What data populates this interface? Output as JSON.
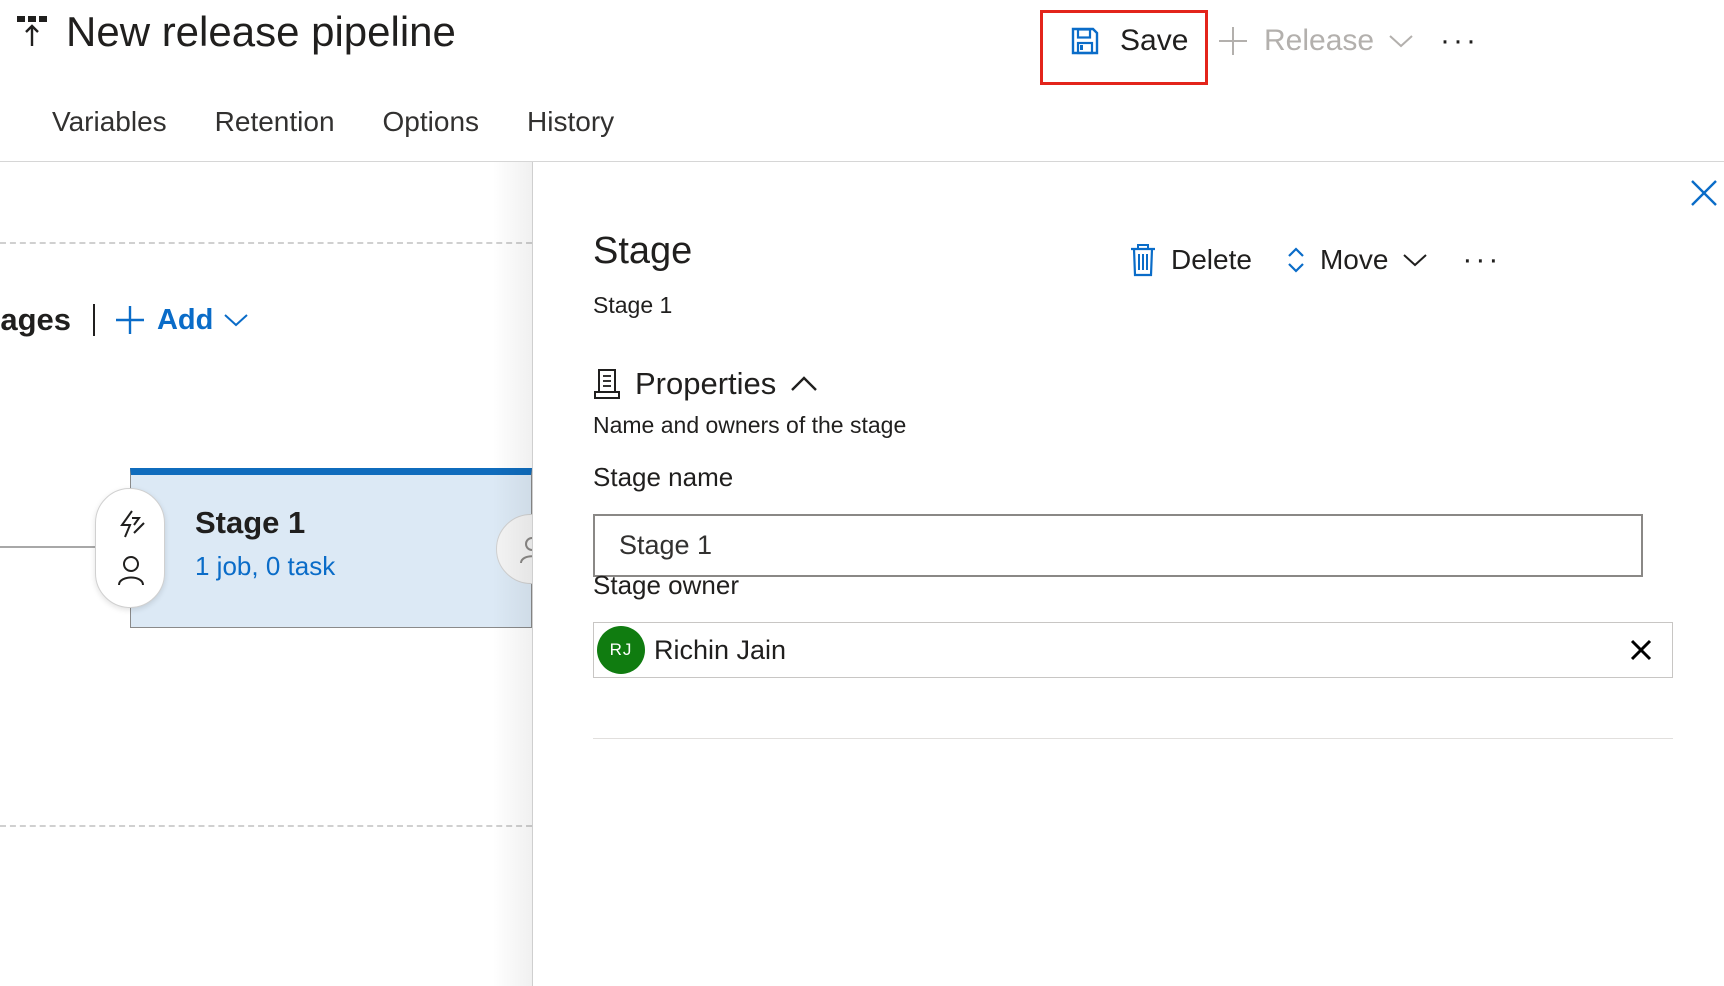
{
  "header": {
    "title": "New release pipeline",
    "pipeline_icon": "release-pipeline-icon",
    "save_label": "Save",
    "save_icon": "floppy-disk-icon",
    "release_label": "Release",
    "release_icon": "plus-icon",
    "release_enabled": false,
    "more_label": "···",
    "highlight_color": "#e3241b"
  },
  "tabs": [
    {
      "label": "Variables"
    },
    {
      "label": "Retention"
    },
    {
      "label": "Options"
    },
    {
      "label": "History"
    }
  ],
  "canvas": {
    "stages_label": "tages",
    "add_label": "Add",
    "stage_card": {
      "name": "Stage 1",
      "summary": "1 job, 0 task",
      "accent_color": "#0f6cbd",
      "background": "#dce9f5"
    }
  },
  "panel": {
    "title": "Stage",
    "subtitle": "Stage 1",
    "actions": {
      "delete_label": "Delete",
      "move_label": "Move",
      "more_label": "···"
    },
    "properties": {
      "title": "Properties",
      "description": "Name and owners of the stage",
      "expanded": true
    },
    "stage_name": {
      "label": "Stage name",
      "value": "Stage 1"
    },
    "stage_owner": {
      "label": "Stage owner",
      "initials": "RJ",
      "name": "Richin Jain",
      "avatar_color": "#107c10"
    }
  },
  "colors": {
    "link_blue": "#0a6cc8",
    "text": "#201f1e",
    "disabled": "#b3b0ad"
  }
}
